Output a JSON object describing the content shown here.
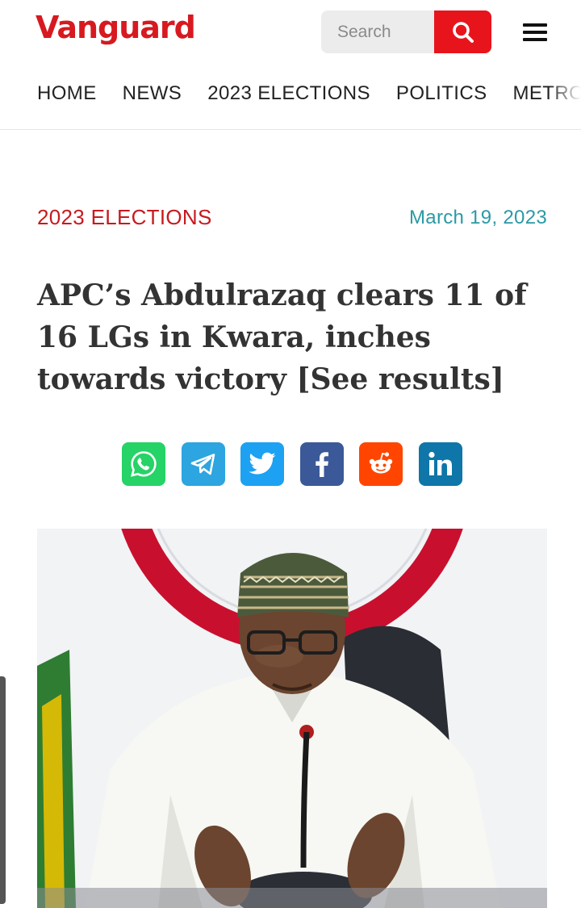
{
  "header": {
    "logo_text": "Vanguard",
    "brand_color": "#d71920",
    "search": {
      "placeholder": "Search",
      "icon": "search-icon"
    },
    "menu_icon": "hamburger-menu-icon"
  },
  "nav": {
    "items": [
      {
        "label": "HOME"
      },
      {
        "label": "NEWS"
      },
      {
        "label": "2023 ELECTIONS"
      },
      {
        "label": "POLITICS"
      },
      {
        "label": "METRO"
      }
    ]
  },
  "article": {
    "category": "2023 ELECTIONS",
    "category_color": "#c71a1f",
    "date": "March 19, 2023",
    "date_color": "#2a9aa6",
    "headline": "APC’s Abdulrazaq clears 11 of 16 LGs in Kwara, inches towards victory [See results]",
    "share": [
      {
        "network": "whatsapp",
        "icon": "whatsapp-icon",
        "color": "#25d366"
      },
      {
        "network": "telegram",
        "icon": "telegram-icon",
        "color": "#2ca5e0"
      },
      {
        "network": "twitter",
        "icon": "twitter-icon",
        "color": "#1da1f2"
      },
      {
        "network": "facebook",
        "icon": "facebook-icon",
        "color": "#3b5998"
      },
      {
        "network": "reddit",
        "icon": "reddit-icon",
        "color": "#ff4500"
      },
      {
        "network": "linkedin",
        "icon": "linkedin-icon",
        "color": "#0e76a8"
      }
    ],
    "image_subject": "man in white kaftan and patterned cap speaking into a microphone"
  }
}
